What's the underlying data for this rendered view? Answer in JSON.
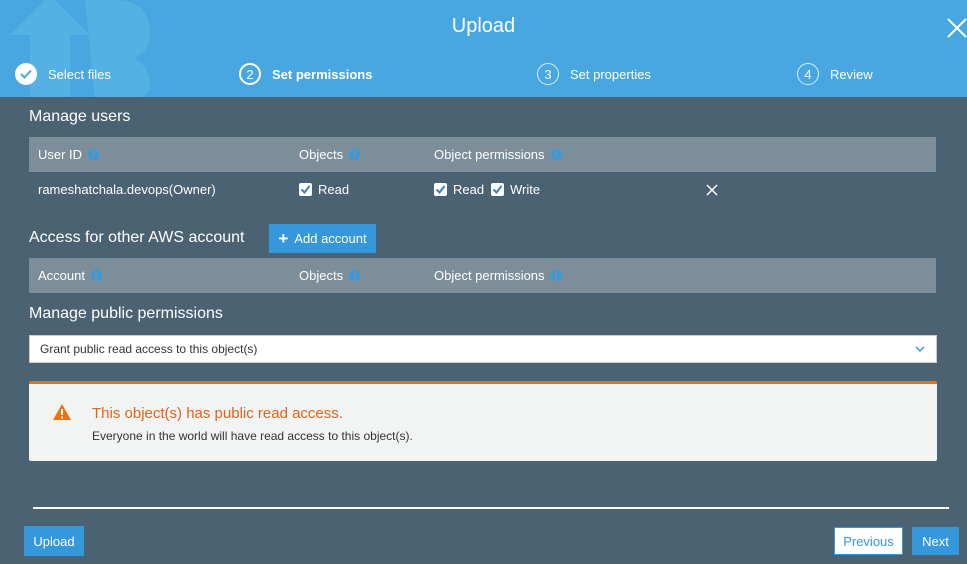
{
  "header": {
    "title": "Upload"
  },
  "steps": [
    {
      "number": "",
      "label": "Select files",
      "state": "done"
    },
    {
      "number": "2",
      "label": "Set permissions",
      "state": "active"
    },
    {
      "number": "3",
      "label": "Set properties",
      "state": "pending"
    },
    {
      "number": "4",
      "label": "Review",
      "state": "pending"
    }
  ],
  "manage_users": {
    "title": "Manage users",
    "columns": [
      "User ID",
      "Objects",
      "Object permissions"
    ],
    "rows": [
      {
        "user_id": "rameshatchala.devops(Owner)",
        "objects_read": "Read",
        "perm_read": "Read",
        "perm_write": "Write"
      }
    ]
  },
  "other_accounts": {
    "title": "Access for other AWS account",
    "add_button": "Add account",
    "columns": [
      "Account",
      "Objects",
      "Object permissions"
    ]
  },
  "public_permissions": {
    "title": "Manage public permissions",
    "selected": "Grant public read access to this object(s)"
  },
  "alert": {
    "title": "This object(s) has public read access.",
    "body": "Everyone in the world will have read access to this object(s)."
  },
  "footer": {
    "upload": "Upload",
    "previous": "Previous",
    "next": "Next"
  },
  "colors": {
    "header": "#48a7e0",
    "body": "#4b6272",
    "accent": "#3498db",
    "warning": "#e1631a"
  }
}
